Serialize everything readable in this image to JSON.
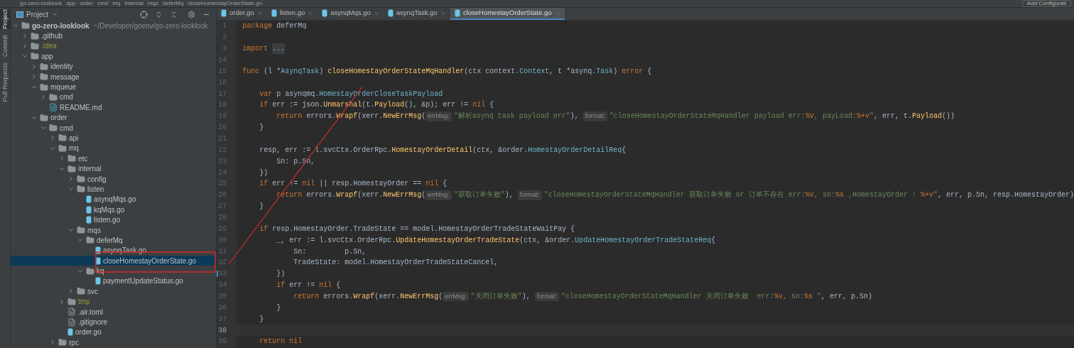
{
  "breadcrumb": [
    "go-zero-looklook",
    "app",
    "order",
    "cmd",
    "mq",
    "internal",
    "mqs",
    "deferMq",
    "closeHomestayOrderState.go"
  ],
  "run_config": {
    "label": "Add Configurati"
  },
  "side_strip": [
    {
      "label": "Project",
      "selected": true
    },
    {
      "label": "Commit",
      "selected": false
    },
    {
      "label": "Pull Requests",
      "selected": false
    }
  ],
  "project_panel": {
    "title": "Project",
    "tree": [
      {
        "name": "go-zero-looklook",
        "hint": "~/Developer/goenv/go-zero-looklook",
        "kind": "module",
        "expanded": true,
        "selected": false,
        "ignored": false,
        "children": [
          {
            "name": ".github",
            "kind": "folder",
            "expanded": false,
            "selected": false,
            "ignored": false
          },
          {
            "name": ".idea",
            "kind": "folder",
            "expanded": false,
            "selected": false,
            "ignored": true
          },
          {
            "name": "app",
            "kind": "folder",
            "expanded": true,
            "selected": false,
            "ignored": false,
            "children": [
              {
                "name": "identity",
                "kind": "folder",
                "expanded": false,
                "selected": false,
                "ignored": false
              },
              {
                "name": "message",
                "kind": "folder",
                "expanded": false,
                "selected": false,
                "ignored": false
              },
              {
                "name": "mqueue",
                "kind": "folder",
                "expanded": true,
                "selected": false,
                "ignored": false,
                "children": [
                  {
                    "name": "cmd",
                    "kind": "folder",
                    "expanded": false,
                    "selected": false,
                    "ignored": false
                  },
                  {
                    "name": "README.md",
                    "kind": "md",
                    "selected": false,
                    "ignored": false
                  }
                ]
              },
              {
                "name": "order",
                "kind": "folder",
                "expanded": true,
                "selected": false,
                "ignored": false,
                "children": [
                  {
                    "name": "cmd",
                    "kind": "folder",
                    "expanded": true,
                    "selected": false,
                    "ignored": false,
                    "children": [
                      {
                        "name": "api",
                        "kind": "folder",
                        "expanded": false,
                        "selected": false,
                        "ignored": false
                      },
                      {
                        "name": "mq",
                        "kind": "folder",
                        "expanded": true,
                        "selected": false,
                        "ignored": false,
                        "children": [
                          {
                            "name": "etc",
                            "kind": "folder",
                            "expanded": false,
                            "selected": false,
                            "ignored": false
                          },
                          {
                            "name": "internal",
                            "kind": "folder",
                            "expanded": true,
                            "selected": false,
                            "ignored": false,
                            "children": [
                              {
                                "name": "config",
                                "kind": "folder",
                                "expanded": false,
                                "selected": false,
                                "ignored": false
                              },
                              {
                                "name": "listen",
                                "kind": "folder",
                                "expanded": true,
                                "selected": false,
                                "ignored": false,
                                "children": [
                                  {
                                    "name": "asynqMqs.go",
                                    "kind": "go",
                                    "selected": false,
                                    "ignored": false
                                  },
                                  {
                                    "name": "kqMqs.go",
                                    "kind": "go",
                                    "selected": false,
                                    "ignored": false
                                  },
                                  {
                                    "name": "listen.go",
                                    "kind": "go",
                                    "selected": false,
                                    "ignored": false
                                  }
                                ]
                              },
                              {
                                "name": "mqs",
                                "kind": "folder",
                                "expanded": true,
                                "selected": false,
                                "ignored": false,
                                "children": [
                                  {
                                    "name": "deferMq",
                                    "kind": "folder",
                                    "expanded": true,
                                    "selected": false,
                                    "ignored": false,
                                    "children": [
                                      {
                                        "name": "asynqTask.go",
                                        "kind": "go",
                                        "selected": false,
                                        "ignored": false
                                      },
                                      {
                                        "name": "closeHomestayOrderState.go",
                                        "kind": "go",
                                        "selected": true,
                                        "ignored": false
                                      }
                                    ]
                                  },
                                  {
                                    "name": "kq",
                                    "kind": "folder",
                                    "expanded": true,
                                    "selected": false,
                                    "ignored": false,
                                    "children": [
                                      {
                                        "name": "paymentUpdateStatus.go",
                                        "kind": "go",
                                        "selected": false,
                                        "ignored": false
                                      }
                                    ]
                                  }
                                ]
                              },
                              {
                                "name": "svc",
                                "kind": "folder",
                                "expanded": false,
                                "selected": false,
                                "ignored": false
                              }
                            ]
                          },
                          {
                            "name": "tmp",
                            "kind": "folder",
                            "expanded": false,
                            "selected": false,
                            "ignored": true
                          },
                          {
                            "name": ".air.toml",
                            "kind": "text",
                            "selected": false,
                            "ignored": false
                          },
                          {
                            "name": ".gitignore",
                            "kind": "text",
                            "selected": false,
                            "ignored": false
                          },
                          {
                            "name": "order.go",
                            "kind": "go",
                            "selected": false,
                            "ignored": false
                          }
                        ]
                      },
                      {
                        "name": "rpc",
                        "kind": "folder",
                        "expanded": false,
                        "selected": false,
                        "ignored": false
                      }
                    ]
                  }
                ]
              }
            ]
          }
        ]
      }
    ]
  },
  "editor_tabs": [
    {
      "label": "order.go",
      "selected": false
    },
    {
      "label": "listen.go",
      "selected": false
    },
    {
      "label": "asynqMqs.go",
      "selected": false
    },
    {
      "label": "asynqTask.go",
      "selected": false
    },
    {
      "label": "closeHomestayOrderState.go",
      "selected": true
    }
  ],
  "code_lines": [
    {
      "number": "1",
      "current": false,
      "tokens": [
        {
          "kind": "kw",
          "text": "package "
        },
        {
          "kind": "plain",
          "text": "deferMq"
        }
      ]
    },
    {
      "number": "2",
      "current": false
    },
    {
      "number": "3",
      "current": false,
      "tokens": [
        {
          "kind": "kw",
          "text": "import "
        },
        {
          "kind": "fold",
          "text": "..."
        }
      ]
    },
    {
      "number": "14",
      "current": false
    },
    {
      "number": "15",
      "current": false,
      "tokens": [
        {
          "kind": "kw",
          "text": "func "
        },
        {
          "kind": "plain",
          "text": "(l *"
        },
        {
          "kind": "type",
          "text": "AsynqTask"
        },
        {
          "kind": "plain",
          "text": ") "
        },
        {
          "kind": "fn",
          "text": "closeHomestayOrderStateMqHandler"
        },
        {
          "kind": "plain",
          "text": "(ctx context."
        },
        {
          "kind": "type",
          "text": "Context"
        },
        {
          "kind": "plain",
          "text": ", t *asynq."
        },
        {
          "kind": "type",
          "text": "Task"
        },
        {
          "kind": "plain",
          "text": ") "
        },
        {
          "kind": "kw",
          "text": "error"
        },
        {
          "kind": "plain",
          "text": " {"
        }
      ]
    },
    {
      "number": "16",
      "current": false
    },
    {
      "number": "17",
      "current": false,
      "tokens": [
        {
          "kind": "kw",
          "text": "    var "
        },
        {
          "kind": "plain",
          "text": "p asynqmq."
        },
        {
          "kind": "type",
          "text": "HomestayOrderCloseTaskPayload"
        }
      ]
    },
    {
      "number": "18",
      "current": false,
      "tokens": [
        {
          "kind": "kw",
          "text": "    if "
        },
        {
          "kind": "plain",
          "text": "err := json."
        },
        {
          "kind": "fn",
          "text": "Unmarshal"
        },
        {
          "kind": "plain",
          "text": "(t."
        },
        {
          "kind": "fn",
          "text": "Payload"
        },
        {
          "kind": "plain",
          "text": "(), &p); err != "
        },
        {
          "kind": "kw",
          "text": "nil"
        },
        {
          "kind": "plain",
          "text": " {"
        }
      ]
    },
    {
      "number": "19",
      "current": false,
      "tokens": [
        {
          "kind": "kw",
          "text": "        return "
        },
        {
          "kind": "plain",
          "text": "errors."
        },
        {
          "kind": "fn",
          "text": "Wrapf"
        },
        {
          "kind": "plain",
          "text": "(xerr."
        },
        {
          "kind": "fn",
          "text": "NewErrMsg"
        },
        {
          "kind": "plain",
          "text": "("
        },
        {
          "kind": "hint",
          "text": "errMsg:"
        },
        {
          "kind": "str",
          "text": "\"解析asynq task payload err\""
        },
        {
          "kind": "plain",
          "text": "), "
        },
        {
          "kind": "hint",
          "text": "format:"
        },
        {
          "kind": "str",
          "text": "\"closeHomestayOrderStateMqHandler payload err:"
        },
        {
          "kind": "esc",
          "text": "%v"
        },
        {
          "kind": "str",
          "text": ", payLoad:"
        },
        {
          "kind": "esc",
          "text": "%+v"
        },
        {
          "kind": "str",
          "text": "\""
        },
        {
          "kind": "plain",
          "text": ", err, t."
        },
        {
          "kind": "fn",
          "text": "Payload"
        },
        {
          "kind": "plain",
          "text": "())"
        }
      ]
    },
    {
      "number": "20",
      "current": false,
      "tokens": [
        {
          "kind": "plain",
          "text": "    }"
        }
      ]
    },
    {
      "number": "21",
      "current": false
    },
    {
      "number": "22",
      "current": false,
      "tokens": [
        {
          "kind": "plain",
          "text": "    resp, err := l.svcCtx.OrderRpc."
        },
        {
          "kind": "fn",
          "text": "HomestayOrderDetail"
        },
        {
          "kind": "plain",
          "text": "(ctx, &order."
        },
        {
          "kind": "type",
          "text": "HomestayOrderDetailReq"
        },
        {
          "kind": "plain",
          "text": "{"
        }
      ]
    },
    {
      "number": "23",
      "current": false,
      "tokens": [
        {
          "kind": "plain",
          "text": "        Sn: p.Sn,"
        }
      ]
    },
    {
      "number": "24",
      "current": false,
      "tokens": [
        {
          "kind": "plain",
          "text": "    })"
        }
      ]
    },
    {
      "number": "25",
      "current": false,
      "tokens": [
        {
          "kind": "kw",
          "text": "    if "
        },
        {
          "kind": "plain",
          "text": "err != "
        },
        {
          "kind": "kw",
          "text": "nil"
        },
        {
          "kind": "plain",
          "text": " || resp.HomestayOrder == "
        },
        {
          "kind": "kw",
          "text": "nil"
        },
        {
          "kind": "plain",
          "text": " {"
        }
      ]
    },
    {
      "number": "26",
      "current": false,
      "tokens": [
        {
          "kind": "kw",
          "text": "        return "
        },
        {
          "kind": "plain",
          "text": "errors."
        },
        {
          "kind": "fn",
          "text": "Wrapf"
        },
        {
          "kind": "plain",
          "text": "(xerr."
        },
        {
          "kind": "fn",
          "text": "NewErrMsg"
        },
        {
          "kind": "plain",
          "text": "("
        },
        {
          "kind": "hint",
          "text": "errMsg:"
        },
        {
          "kind": "str",
          "text": "\"获取订单失败\""
        },
        {
          "kind": "plain",
          "text": "), "
        },
        {
          "kind": "hint",
          "text": "format:"
        },
        {
          "kind": "str",
          "text": "\"closeHomestayOrderStateMqHandler 获取订单失败 or 订单不存在 err:"
        },
        {
          "kind": "esc",
          "text": "%v"
        },
        {
          "kind": "str",
          "text": ", sn:"
        },
        {
          "kind": "esc",
          "text": "%s"
        },
        {
          "kind": "str",
          "text": " ,HomestayOrder : "
        },
        {
          "kind": "esc",
          "text": "%+v"
        },
        {
          "kind": "str",
          "text": "\""
        },
        {
          "kind": "plain",
          "text": ", err, p.Sn, resp.HomestayOrder)"
        }
      ]
    },
    {
      "number": "27",
      "current": false,
      "tokens": [
        {
          "kind": "plain",
          "text": "    }"
        }
      ]
    },
    {
      "number": "28",
      "current": false
    },
    {
      "number": "29",
      "current": false,
      "tokens": [
        {
          "kind": "kw",
          "text": "    if "
        },
        {
          "kind": "plain",
          "text": "resp.HomestayOrder.TradeState == model.HomestayOrderTradeStateWaitPay {"
        }
      ]
    },
    {
      "number": "30",
      "current": false,
      "tokens": [
        {
          "kind": "plain",
          "text": "        _, err := l.svcCtx.OrderRpc."
        },
        {
          "kind": "fn",
          "text": "UpdateHomestayOrderTradeState"
        },
        {
          "kind": "plain",
          "text": "(ctx, &order."
        },
        {
          "kind": "type",
          "text": "UpdateHomestayOrderTradeStateReq"
        },
        {
          "kind": "plain",
          "text": "{"
        }
      ]
    },
    {
      "number": "31",
      "current": false,
      "tokens": [
        {
          "kind": "plain",
          "text": "            Sn:         p.Sn,"
        }
      ]
    },
    {
      "number": "32",
      "current": false,
      "tokens": [
        {
          "kind": "plain",
          "text": "            TradeState: model.HomestayOrderTradeStateCancel,"
        }
      ]
    },
    {
      "number": "33",
      "current": false,
      "tokens": [
        {
          "kind": "plain",
          "text": "        })"
        }
      ]
    },
    {
      "number": "34",
      "current": false,
      "tokens": [
        {
          "kind": "kw",
          "text": "        if "
        },
        {
          "kind": "plain",
          "text": "err != "
        },
        {
          "kind": "kw",
          "text": "nil"
        },
        {
          "kind": "plain",
          "text": " {"
        }
      ]
    },
    {
      "number": "35",
      "current": false,
      "tokens": [
        {
          "kind": "kw",
          "text": "            return "
        },
        {
          "kind": "plain",
          "text": "errors."
        },
        {
          "kind": "fn",
          "text": "Wrapf"
        },
        {
          "kind": "plain",
          "text": "(xerr."
        },
        {
          "kind": "fn",
          "text": "NewErrMsg"
        },
        {
          "kind": "plain",
          "text": "("
        },
        {
          "kind": "hint",
          "text": "errMsg:"
        },
        {
          "kind": "str",
          "text": "\"关闭订单失败\""
        },
        {
          "kind": "plain",
          "text": "), "
        },
        {
          "kind": "hint",
          "text": "format:"
        },
        {
          "kind": "str",
          "text": "\"closeHomestayOrderStateMqHandler 关闭订单失败  err:"
        },
        {
          "kind": "esc",
          "text": "%v"
        },
        {
          "kind": "str",
          "text": ", sn:"
        },
        {
          "kind": "esc",
          "text": "%s"
        },
        {
          "kind": "str",
          "text": " \""
        },
        {
          "kind": "plain",
          "text": ", err, p.Sn)"
        }
      ]
    },
    {
      "number": "36",
      "current": false,
      "tokens": [
        {
          "kind": "plain",
          "text": "        }"
        }
      ]
    },
    {
      "number": "37",
      "current": false,
      "tokens": [
        {
          "kind": "plain",
          "text": "    }"
        }
      ]
    },
    {
      "number": "38",
      "current": true
    },
    {
      "number": "39",
      "current": false,
      "tokens": [
        {
          "kind": "kw",
          "text": "    return "
        },
        {
          "kind": "kw",
          "text": "nil"
        }
      ]
    }
  ]
}
